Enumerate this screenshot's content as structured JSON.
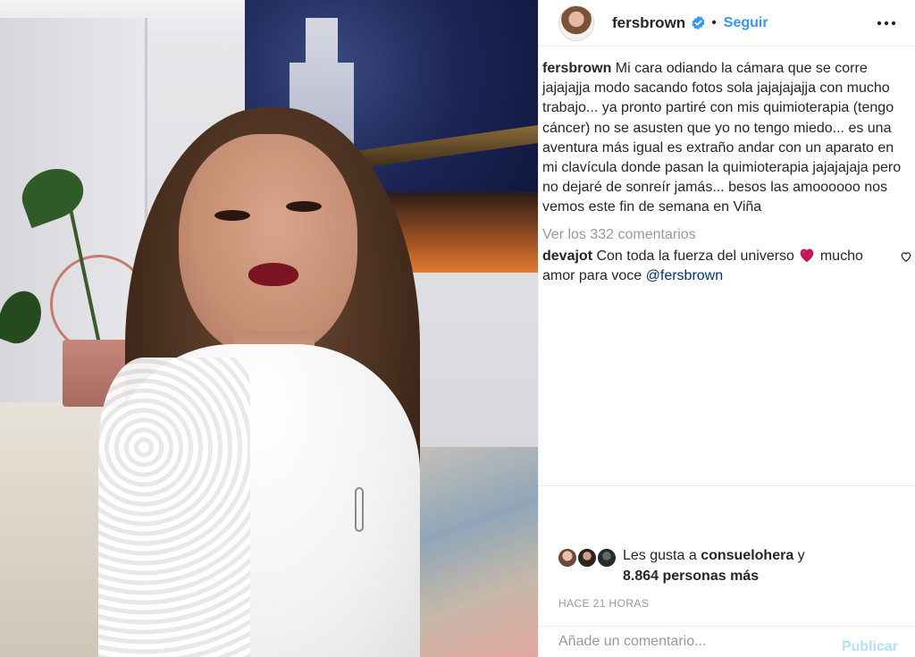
{
  "post": {
    "username": "fersbrown",
    "follow_label": "Seguir",
    "separator": "•"
  },
  "caption": {
    "username": "fersbrown",
    "text": "Mi cara odiando la cámara que se corre jajajajja modo sacando fotos sola jajajajajja con mucho trabajo... ya pronto partiré con mis quimioterapia (tengo cáncer) no se asusten que yo no tengo miedo... es una aventura más igual es extraño andar con un aparato en mi clavícula donde pasan la quimioterapia jajajajaja pero no dejaré de sonreír jamás... besos las amoooooo nos vemos este fin de semana en Viña"
  },
  "view_all_comments": "Ver los 332 comentarios",
  "comments": [
    {
      "username": "devajot",
      "text_before": "Con toda la fuerza del universo",
      "emoji": "heart-emoji",
      "text_after": "mucho amor para voce",
      "mention": "@fersbrown"
    }
  ],
  "likes": {
    "prefix": "Les gusta a",
    "first_user": "consuelohera",
    "connector": "y",
    "others": "8.864 personas más"
  },
  "timestamp": "HACE 21 HORAS",
  "add_comment": {
    "placeholder": "Añade un comentario...",
    "publish_label": "Publicar"
  },
  "colors": {
    "link_blue": "#3897f0",
    "publish_disabled": "#b2dffc",
    "muted": "#999999",
    "text": "#262626",
    "verified": "#3897f0",
    "heart": "#c2185b"
  },
  "icons": [
    "verified-badge-icon",
    "more-options-icon",
    "heart-outline-icon",
    "heart-emoji"
  ]
}
